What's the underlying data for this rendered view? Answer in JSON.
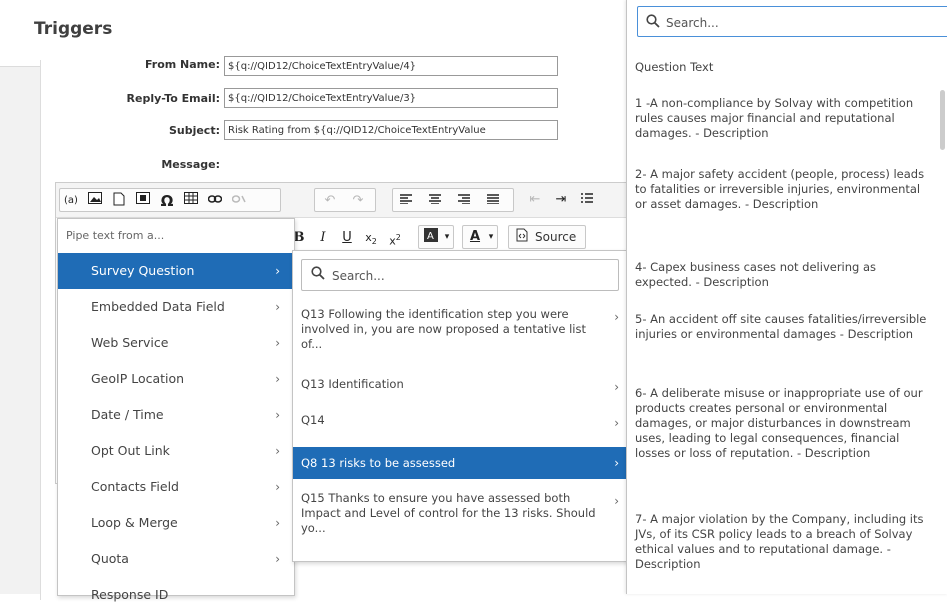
{
  "header": {
    "title": "Triggers"
  },
  "form": {
    "from_name_label": "From Name:",
    "from_name_value": "${q://QID12/ChoiceTextEntryValue/4}",
    "reply_to_label": "Reply-To Email:",
    "reply_to_value": "${q://QID12/ChoiceTextEntryValue/3}",
    "subject_label": "Subject:",
    "subject_value": "Risk Rating from ${q://QID12/ChoiceTextEntryValue",
    "message_label": "Message:"
  },
  "toolbar": {
    "pipe_icon": "(a)",
    "omega": "Ω",
    "source_label": "Source"
  },
  "pipe_menu": {
    "header": "Pipe text from a...",
    "items": [
      {
        "label": "Survey Question",
        "selected": true
      },
      {
        "label": "Embedded Data Field"
      },
      {
        "label": "Web Service"
      },
      {
        "label": "GeoIP Location"
      },
      {
        "label": "Date / Time"
      },
      {
        "label": "Opt Out Link"
      },
      {
        "label": "Contacts Field"
      },
      {
        "label": "Loop & Merge"
      },
      {
        "label": "Quota"
      },
      {
        "label": "Response ID"
      }
    ]
  },
  "question_menu": {
    "search_placeholder": "Search...",
    "items": [
      {
        "label": "Q13 Following the identification step you were involved in, you are now proposed a tentative list of..."
      },
      {
        "label": "Q13 Identification"
      },
      {
        "label": "Q14"
      },
      {
        "label": "Q8 13 risks to be assessed",
        "selected": true
      },
      {
        "label": "Q15 Thanks to ensure you have assessed both Impact and Level of control for the 13 risks. Should yo..."
      }
    ]
  },
  "right_panel": {
    "search_placeholder": "Search...",
    "items": [
      {
        "label": "Question Text"
      },
      {
        "label": "1 -A non-compliance by Solvay with competition rules causes major financial and reputational damages. - Description"
      },
      {
        "label": "2- A major safety accident (people, process) leads to fatalities or irreversible injuries, environmental or asset damages. - Description"
      },
      {
        "label": "4- Capex business cases not delivering as expected. - Description"
      },
      {
        "label": "5- An accident off site causes fatalities/irreversible injuries or environmental damages - Description"
      },
      {
        "label": "6- A deliberate misuse or inappropriate use of our products creates personal or environmental damages, or major disturbances in downstream uses, leading to legal consequences, financial losses or loss of reputation. - Description"
      },
      {
        "label": "7- A major violation by the Company, including its JVs, of its CSR policy leads to a breach of Solvay ethical values and to reputational damage. - Description"
      }
    ]
  }
}
